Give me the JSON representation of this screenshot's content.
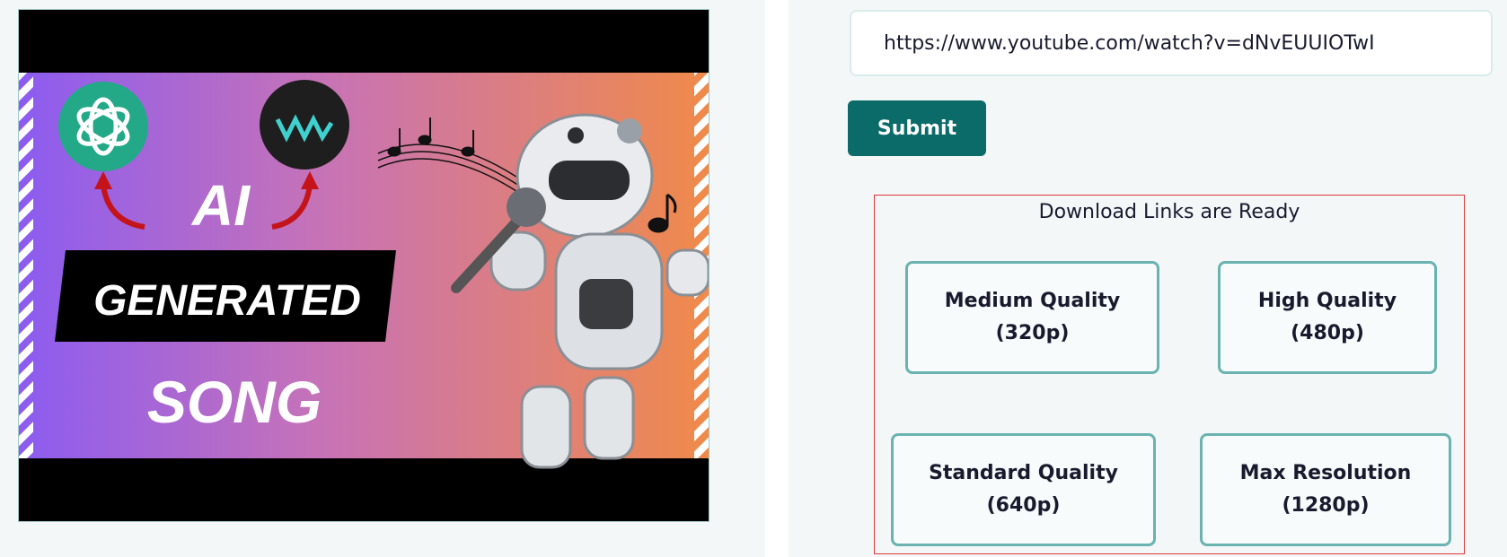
{
  "thumbnail": {
    "title_lines": [
      "AI",
      "GENERATED",
      "SONG"
    ],
    "logo_text": "VM"
  },
  "form": {
    "url_value": "https://www.youtube.com/watch?v=dNvEUUIOTwI",
    "submit_label": "Submit"
  },
  "downloads": {
    "heading": "Download Links are Ready",
    "options": [
      {
        "name": "Medium Quality",
        "res": "(320p)"
      },
      {
        "name": "High Quality",
        "res": "(480p)"
      },
      {
        "name": "Standard Quality",
        "res": "(640p)"
      },
      {
        "name": "Max Resolution",
        "res": "(1280p)"
      }
    ]
  },
  "colors": {
    "accent": "#0a6b69",
    "button_border": "#6ab3b1",
    "box_border": "#e0363a",
    "openai_logo_bg": "#23a888",
    "vm_logo_bg": "#1e1e1e",
    "thumb_gradient_left": "#8c5cf0",
    "thumb_gradient_right": "#f08a4a"
  }
}
